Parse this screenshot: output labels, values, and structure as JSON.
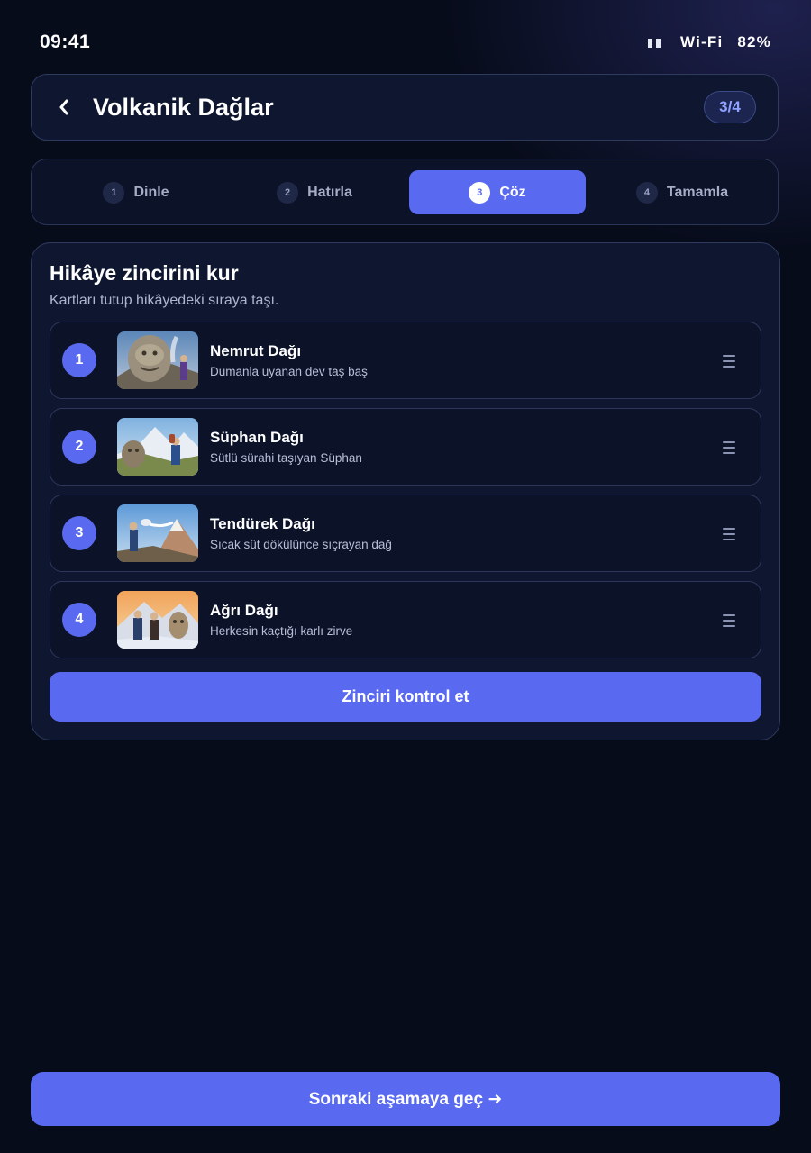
{
  "status_bar": {
    "time": "09:41",
    "network": "Wi-Fi",
    "battery": "82%"
  },
  "header": {
    "title": "Volkanik Dağlar",
    "progress": "3/4",
    "back_icon": "chevron-left-icon"
  },
  "stepper": {
    "steps": [
      {
        "num": "1",
        "label": "Dinle"
      },
      {
        "num": "2",
        "label": "Hatırla"
      },
      {
        "num": "3",
        "label": "Çöz"
      },
      {
        "num": "4",
        "label": "Tamamla"
      }
    ],
    "active_step": 3
  },
  "puzzle": {
    "title": "Hikâye zincirini kur",
    "subtitle": "Kartları tutup hikâyedeki sıraya taşı.",
    "items": [
      {
        "order": "1",
        "name": "Nemrut Dağı",
        "desc": "Dumanla uyanan dev taş baş"
      },
      {
        "order": "2",
        "name": "Süphan Dağı",
        "desc": "Sütlü sürahi taşıyan Süphan"
      },
      {
        "order": "3",
        "name": "Tendürek Dağı",
        "desc": "Sıcak süt dökülünce sıçrayan dağ"
      },
      {
        "order": "4",
        "name": "Ağrı Dağı",
        "desc": "Herkesin kaçtığı karlı zirve"
      }
    ],
    "check_label": "Zinciri kontrol et"
  },
  "footer": {
    "next_label": "Sonraki aşamaya geç ➜"
  },
  "colors": {
    "accent": "#5a6af0",
    "background": "#070c1b",
    "card": "#0f1730"
  }
}
